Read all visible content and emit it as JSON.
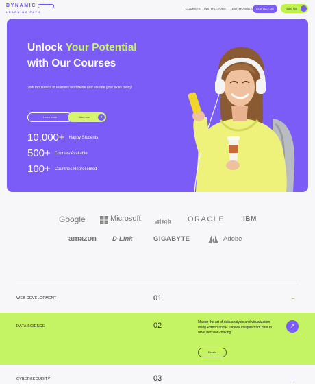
{
  "brand": {
    "name": "DYNAMIC",
    "tagline": "LEARNING PATH"
  },
  "nav": {
    "links": [
      "COURSES",
      "INSTRUCTORS",
      "TESTIMONIALS"
    ],
    "contact_label": "CONTACT US",
    "signup_label": "Sign Up"
  },
  "hero": {
    "title_pre": "Unlock ",
    "title_highlight": "Your Potential",
    "title_line2": "with Our Courses",
    "description": "Join thousands of learners worldwide and elevate your skills today!",
    "learn_more_label": "Learn more",
    "join_now_label": "Join now",
    "stats": [
      {
        "number": "10,000+",
        "label": "Happy Students"
      },
      {
        "number": "500+",
        "label": "Courses Available"
      },
      {
        "number": "100+",
        "label": "Countries Represented"
      }
    ]
  },
  "partners": [
    "Google",
    "Microsoft",
    "CISCO",
    "ORACLE",
    "IBM",
    "amazon",
    "D-Link",
    "GIGABYTE",
    "Adobe"
  ],
  "courses": [
    {
      "name": "WEB DEVELOPMENT",
      "number": "01"
    },
    {
      "name": "DATA SCIENCE",
      "number": "02",
      "description": "Master the art of data analysis and visualization using Python and R. Unlock insights from data to drive decision-making.",
      "details_label": "Details"
    },
    {
      "name": "CYBERSECURITY",
      "number": "03"
    }
  ],
  "colors": {
    "primary": "#7b5cf6",
    "accent": "#c4f463",
    "background": "#f7f7f9"
  }
}
